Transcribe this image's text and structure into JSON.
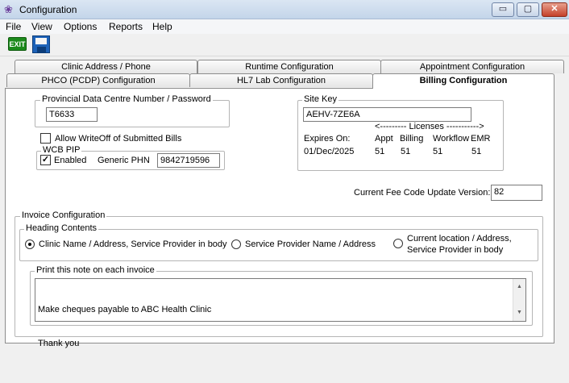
{
  "window": {
    "title": "Configuration",
    "minimize": "▭",
    "maximize": "▢",
    "close": "✕"
  },
  "menu": [
    "File",
    "View",
    "Options",
    "Reports",
    "Help"
  ],
  "toolbar": {
    "exit_label": "EXIT"
  },
  "tabs_row1": [
    "Clinic Address / Phone",
    "Runtime Configuration",
    "Appointment Configuration"
  ],
  "tabs_row2": [
    "PHCO (PCDP) Configuration",
    "HL7 Lab Configuration",
    "Billing Configuration"
  ],
  "provincial": {
    "legend": "Provincial Data Centre Number / Password",
    "value": "T6633"
  },
  "writeoff": {
    "label": "Allow WriteOff of Submitted Bills",
    "checked": false
  },
  "wcb": {
    "legend": "WCB PIP",
    "enabled_label": "Enabled",
    "enabled": true,
    "phn_label": "Generic PHN",
    "phn_value": "9842719596"
  },
  "site": {
    "legend": "Site Key",
    "key": "AEHV-7ZE6A",
    "licenses_header": "<--------- Licenses ----------->",
    "expires_label": "Expires On:",
    "expires_value": "01/Dec/2025",
    "cols": [
      "Appt",
      "Billing",
      "Workflow",
      "EMR"
    ],
    "values": [
      "51",
      "51",
      "51",
      "51"
    ]
  },
  "fee": {
    "label": "Current Fee Code Update Version:",
    "value": "82"
  },
  "invoice": {
    "legend": "Invoice Configuration",
    "heading_legend": "Heading Contents",
    "options": [
      "Clinic Name / Address, Service Provider in body",
      "Service Provider Name / Address",
      "Current location / Address,",
      "Service Provider in body"
    ],
    "selected": 0,
    "note_legend": "Print this note on each invoice",
    "note_line1": "Make cheques payable to ABC Health Clinic",
    "note_line2": "Thank you"
  }
}
